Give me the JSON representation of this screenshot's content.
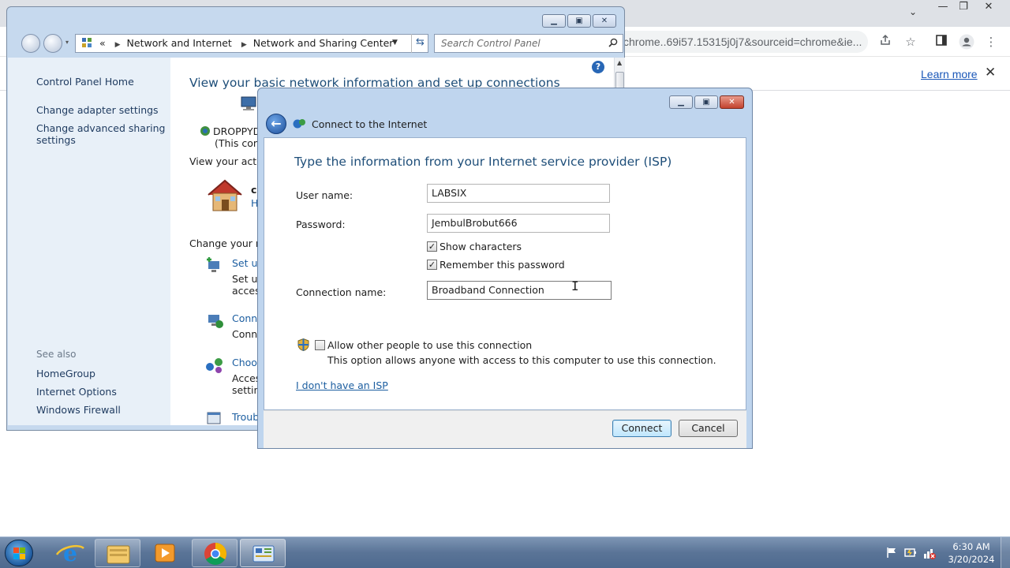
{
  "browser": {
    "tab_dropdown": "⌄",
    "window_controls": {
      "minimize": "—",
      "restore": "❐",
      "close": "✕"
    },
    "url_fragment": "chrome..69i57.15315j0j7&sourceid=chrome&ie...",
    "infobar": {
      "learn_more": "Learn more",
      "close": "✕"
    }
  },
  "control_panel": {
    "breadcrumb": {
      "root_glyph": "«",
      "item1": "Network and Internet",
      "item2": "Network and Sharing Center"
    },
    "search_placeholder": "Search Control Panel",
    "left_nav": {
      "home": "Control Panel Home",
      "adapter": "Change adapter settings",
      "advanced_sharing_line1": "Change advanced sharing",
      "advanced_sharing_line2": "settings",
      "see_also": "See also",
      "homegroup": "HomeGroup",
      "internet_options": "Internet Options",
      "windows_firewall": "Windows Firewall"
    },
    "main": {
      "heading": "View your basic network information and set up connections",
      "computer_name": "DROPPYDI",
      "this_computer": "(This comp",
      "active_networks": "View your active",
      "network_name_partial": "co",
      "network_type_partial": "H",
      "change_settings": "Change your net",
      "task1_link": "Set up",
      "task1_desc1": "Set up",
      "task1_desc2": "access",
      "task2_link": "Conne",
      "task2_desc": "Conne",
      "task3_link": "Choos",
      "task3_desc1": "Acces",
      "task3_desc2": "setting",
      "task4_link": "Troub"
    },
    "help_glyph": "?"
  },
  "dialog": {
    "title": "Connect to the Internet",
    "heading": "Type the information from your Internet service provider (ISP)",
    "username_label": "User name:",
    "username_value": "LABSIX",
    "password_label": "Password:",
    "password_value": "JembulBrobut666",
    "show_characters": "Show characters",
    "show_characters_checked": true,
    "remember_password": "Remember this password",
    "remember_password_checked": true,
    "connection_name_label": "Connection name:",
    "connection_name_value": "Broadband Connection",
    "allow_others": "Allow other people to use this connection",
    "allow_others_checked": false,
    "allow_others_desc": "This option allows anyone with access to this computer to use this connection.",
    "no_isp_link": "I don't have an ISP",
    "connect_button": "Connect",
    "cancel_button": "Cancel",
    "check_mark": "✓"
  },
  "taskbar": {
    "time": "6:30 AM",
    "date": "3/20/2024",
    "icons": [
      "start-orb",
      "internet-explorer-icon",
      "file-explorer-icon",
      "media-player-icon",
      "chrome-icon",
      "control-panel-icon"
    ],
    "tray_icons": [
      "action-center-flag-icon",
      "power-icon",
      "network-disconnected-icon"
    ]
  }
}
